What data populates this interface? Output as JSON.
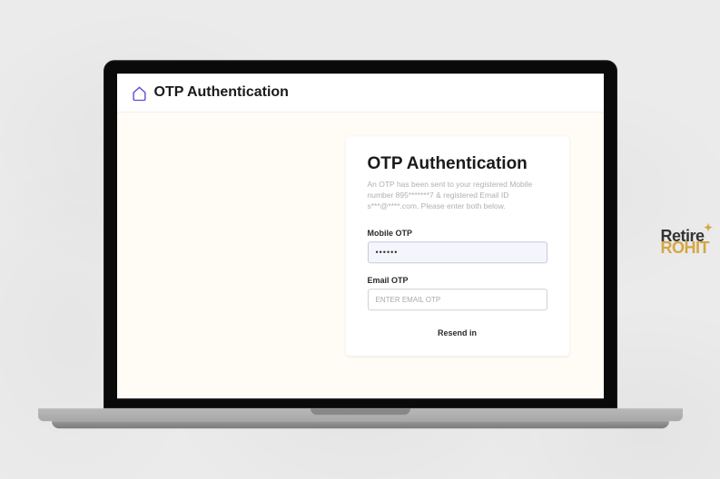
{
  "header": {
    "title": "OTP Authentication"
  },
  "card": {
    "title": "OTP Authentication",
    "hint": "An OTP has been sent to your registered Mobile number 895*******7 & registered Email ID s***@****.com. Please enter both below.",
    "mobile_label": "Mobile OTP",
    "mobile_value": "••••••",
    "email_label": "Email OTP",
    "email_placeholder": "ENTER EMAIL OTP",
    "resend": "Resend in"
  },
  "watermark": {
    "line1": "Retire",
    "line2": "ROHIT"
  }
}
